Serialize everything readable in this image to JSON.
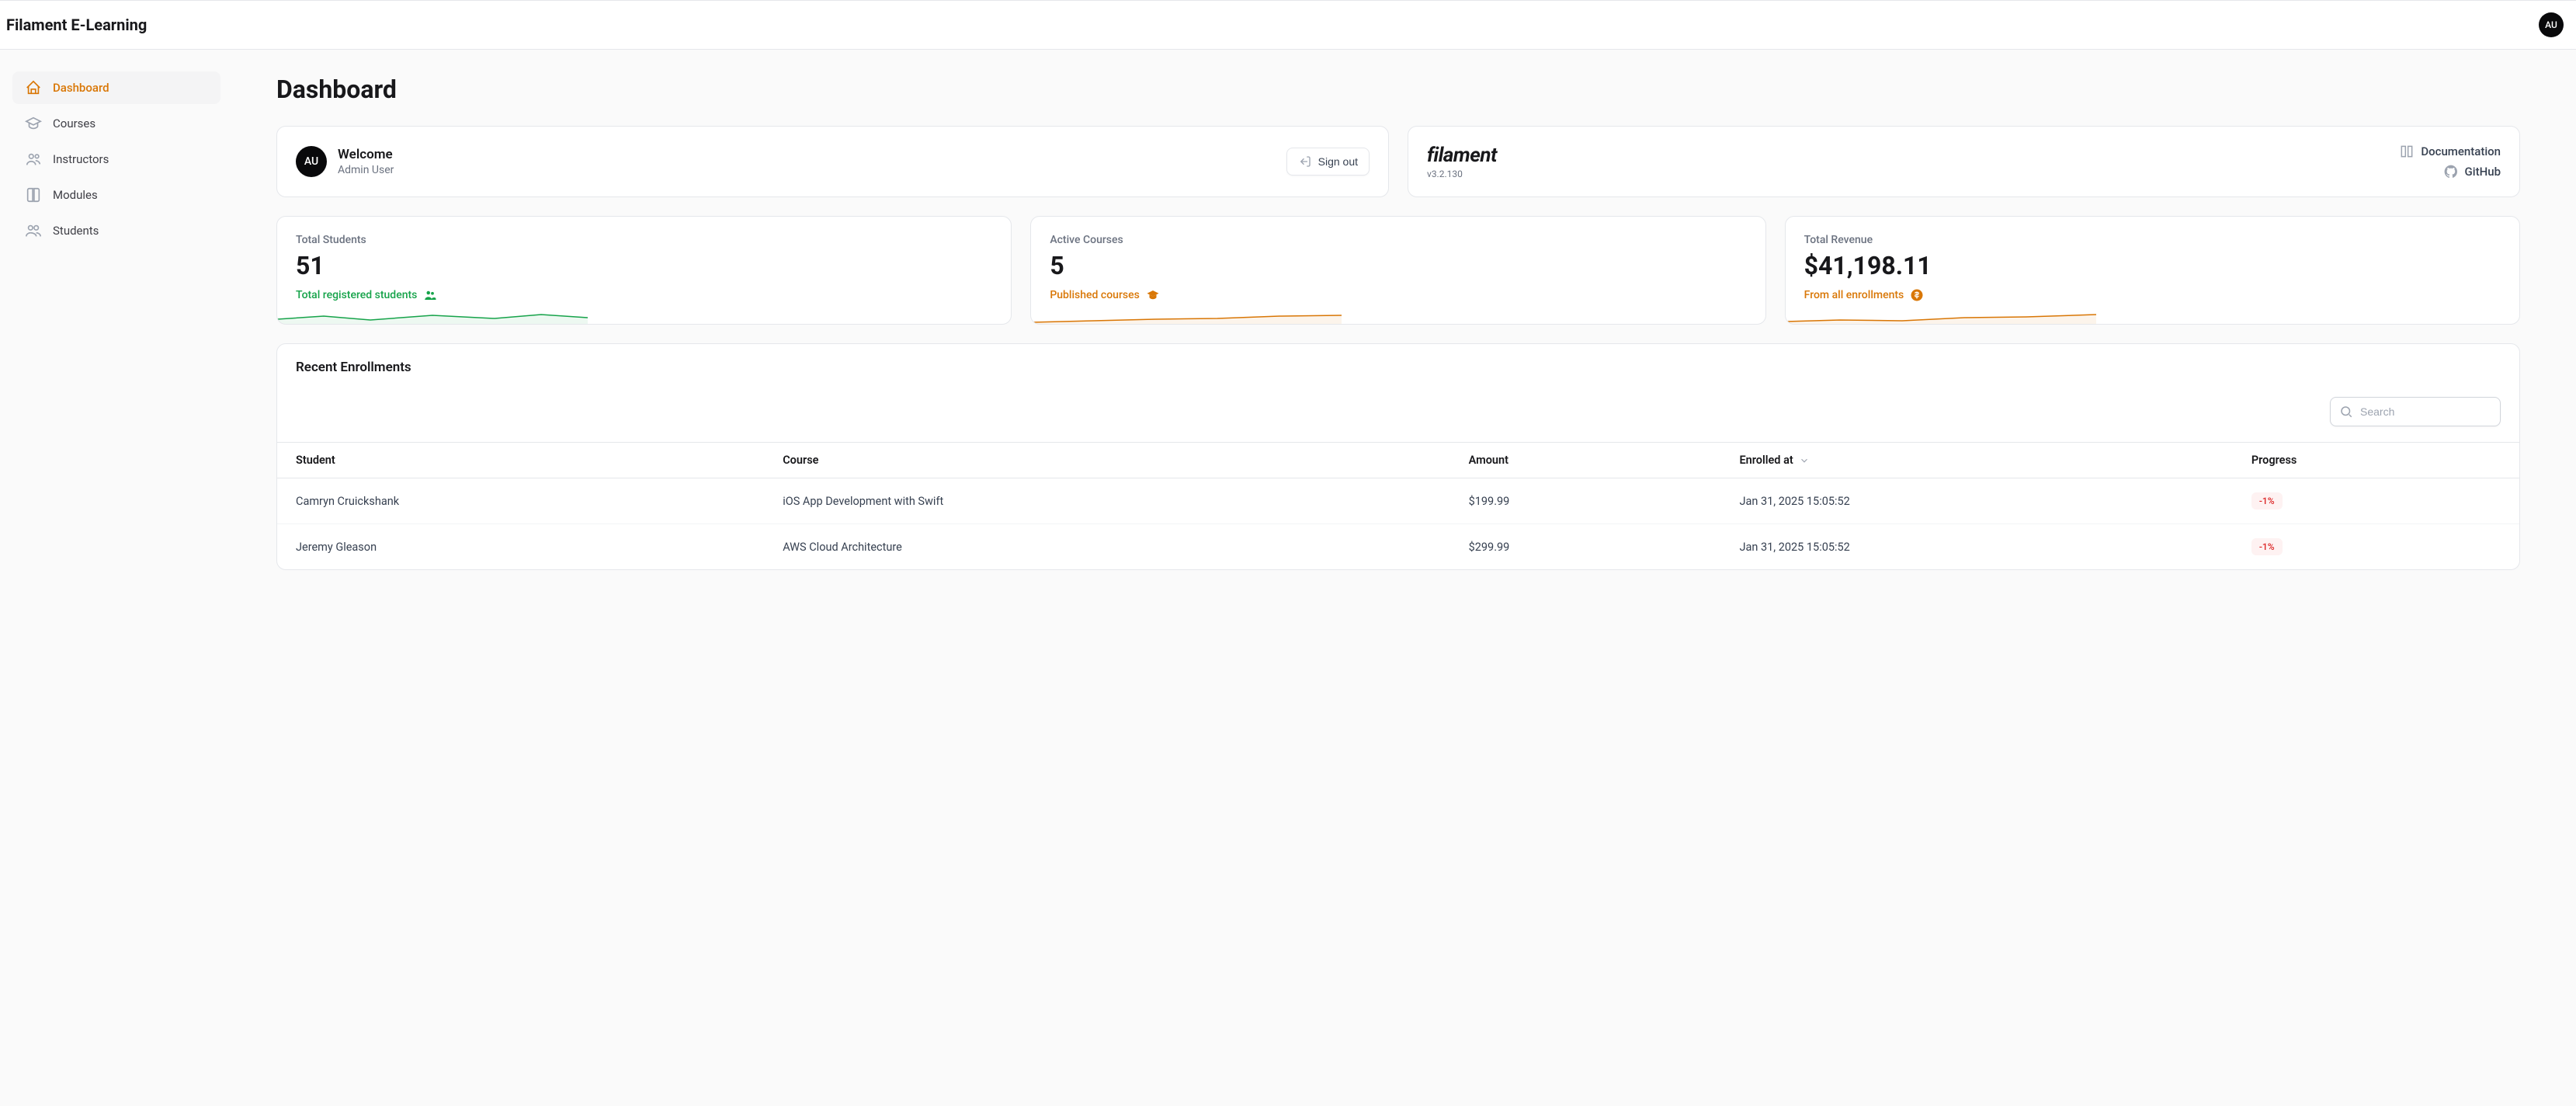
{
  "app_title": "Filament E-Learning",
  "user_initials": "AU",
  "page_title": "Dashboard",
  "sidebar": {
    "items": [
      {
        "label": "Dashboard",
        "active": true,
        "icon": "home"
      },
      {
        "label": "Courses",
        "active": false,
        "icon": "graduation"
      },
      {
        "label": "Instructors",
        "active": false,
        "icon": "users"
      },
      {
        "label": "Modules",
        "active": false,
        "icon": "book"
      },
      {
        "label": "Students",
        "active": false,
        "icon": "group"
      }
    ]
  },
  "welcome": {
    "label": "Welcome",
    "user_name": "Admin User",
    "avatar_initials": "AU",
    "signout_label": "Sign out"
  },
  "filament": {
    "brand": "filament",
    "version": "v3.2.130",
    "documentation_label": "Documentation",
    "github_label": "GitHub"
  },
  "stats": [
    {
      "label": "Total Students",
      "value": "51",
      "desc": "Total registered students",
      "color": "green",
      "icon": "users",
      "spark_color": "#16a34a"
    },
    {
      "label": "Active Courses",
      "value": "5",
      "desc": "Published courses",
      "color": "amber",
      "icon": "graduation",
      "spark_color": "#d97706"
    },
    {
      "label": "Total Revenue",
      "value": "$41,198.11",
      "desc": "From all enrollments",
      "color": "amber",
      "icon": "dollar",
      "spark_color": "#d97706"
    }
  ],
  "enrollments": {
    "title": "Recent Enrollments",
    "search_placeholder": "Search",
    "columns": {
      "student": "Student",
      "course": "Course",
      "amount": "Amount",
      "enrolled_at": "Enrolled at",
      "progress": "Progress"
    },
    "rows": [
      {
        "student": "Camryn Cruickshank",
        "course": "iOS App Development with Swift",
        "amount": "$199.99",
        "enrolled_at": "Jan 31, 2025 15:05:52",
        "progress": "-1%"
      },
      {
        "student": "Jeremy Gleason",
        "course": "AWS Cloud Architecture",
        "amount": "$299.99",
        "enrolled_at": "Jan 31, 2025 15:05:52",
        "progress": "-1%"
      }
    ]
  }
}
